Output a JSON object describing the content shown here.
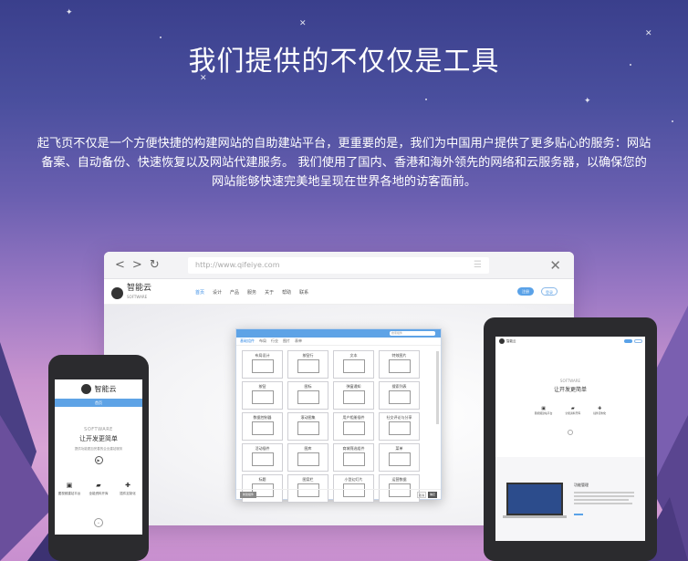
{
  "hero": {
    "title": "我们提供的不仅仅是工具",
    "description": "起飞页不仅是一个方便快捷的构建网站的自助建站平台，更重要的是，我们为中国用户提供了更多贴心的服务：网站备案、自动备份、快速恢复以及网站代建服务。 我们使用了国内、香港和海外领先的网络和云服务器，以确保您的网站能够快速完美地呈现在世界各地的访客面前。"
  },
  "browser": {
    "url_placeholder": "http://www.qifeiye.com",
    "site_logo": "智能云",
    "site_logo_sub": "SOFTWARE",
    "menu": [
      "首页",
      "设计",
      "产品",
      "服务",
      "关于",
      "帮助",
      "联系"
    ],
    "buttons": [
      "注册",
      "登录"
    ]
  },
  "editor": {
    "search_placeholder": "搜索组件",
    "tabs": [
      "基础组件",
      "布局",
      "行业",
      "图片",
      "表单"
    ],
    "widgets": [
      "布局设计",
      "按钮行",
      "文本",
      "特效图片",
      "按钮",
      "图标",
      "弹窗通知",
      "搜索列表",
      "数据控制器",
      "滚动图集",
      "用户相册插件",
      "社交评论与分享",
      "活动插件",
      "图库",
      "商城筛选组件",
      "菜单",
      "标题",
      "图案栏",
      "小型幻灯片",
      "运营数据"
    ],
    "footer_left": "新建组件",
    "footer_cancel": "取消",
    "footer_ok": "确定"
  },
  "phone": {
    "logo": "智能云",
    "nav_label": "首页",
    "software": "SOFTWARE",
    "headline": "让开发更简单",
    "subline": "提供功能更加完善的企业建站服务",
    "features": [
      {
        "icon": "image-icon",
        "label": "图视频建站平台"
      },
      {
        "icon": "folder-icon",
        "label": "全能资料开库"
      },
      {
        "icon": "puzzle-icon",
        "label": "插件定制化"
      }
    ]
  },
  "tablet": {
    "logo": "智能云",
    "software": "SOFTWARE",
    "headline": "让开发更简单",
    "features": [
      "图视频建站平台",
      "全能资料开库",
      "插件定制化"
    ],
    "lower_title": "功能管理"
  }
}
